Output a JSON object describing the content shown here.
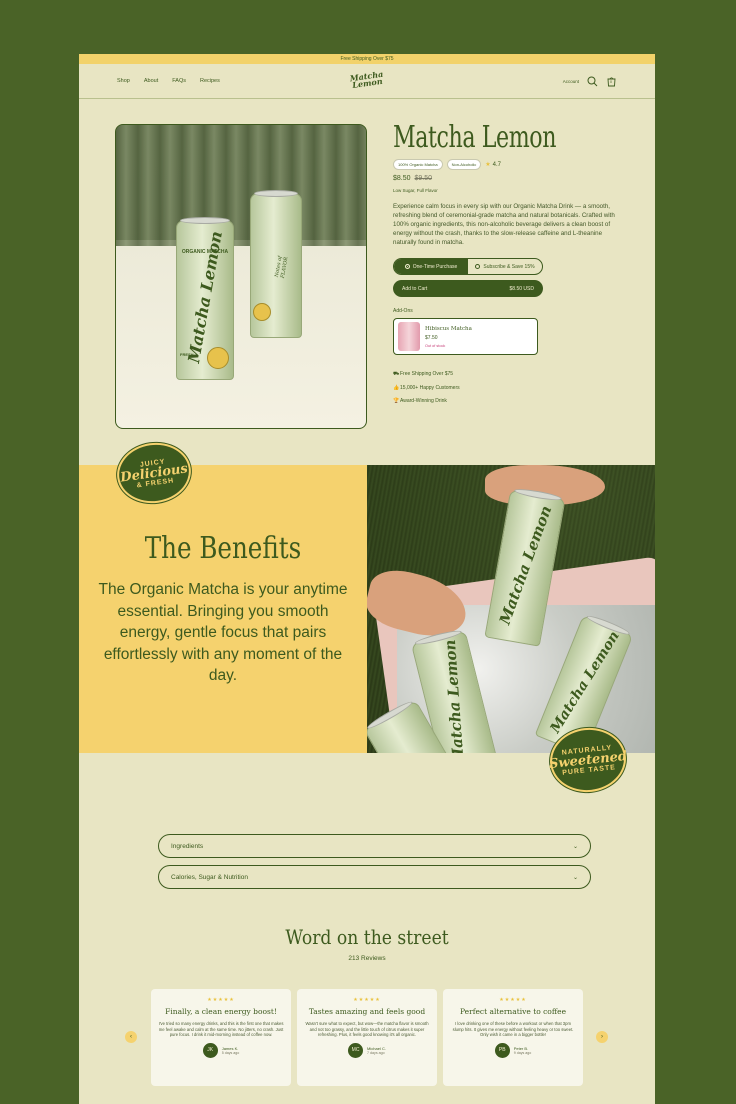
{
  "promo": "Free Shipping Over $75",
  "nav": {
    "links": [
      "Shop",
      "About",
      "FAQs",
      "Recipes"
    ],
    "logo_line1": "Matcha",
    "logo_line2": "Lemon",
    "account": "Account",
    "cart_count": "0"
  },
  "product": {
    "title": "Matcha Lemon",
    "badges": [
      "100% Organic Matcha",
      "Non-Alcoholic"
    ],
    "rating": "4.7",
    "price": "$8.50",
    "old_price": "$9.50",
    "subtitle": "Low Sugar, Full Flavor",
    "description": "Experience calm focus in every sip with our Organic Matcha Drink — a smooth, refreshing blend of ceremonial-grade matcha and natural botanicals. Crafted with 100% organic ingredients, this non-alcoholic beverage delivers a clean boost of energy without the crash, thanks to the slow-release caffeine and L-theanine naturally found in matcha.",
    "purchase_options": [
      "One-Time Purchase",
      "Subscribe & Save 15%"
    ],
    "add_to_cart": "Add to Cart",
    "cart_price": "$8.50 USD",
    "addons_label": "Add-Ons",
    "addon": {
      "name": "Hibiscus Matcha",
      "price": "$7.50",
      "stock": "Out of stock"
    },
    "perks": [
      "Free Shipping Over $75",
      "15,000+ Happy Customers",
      "Award-Winning Drink"
    ]
  },
  "can_labels": {
    "top": "ORGANIC MATCHA",
    "brand": "Matcha Lemon",
    "side": "FRESH",
    "back": "Notes of FLAVOR"
  },
  "sticker1": {
    "a": "JUICY",
    "b": "Delicious",
    "c": "& FRESH"
  },
  "sticker2": {
    "a": "NATURALLY",
    "b": "Sweetened",
    "c": "PURE TASTE"
  },
  "benefits": {
    "title": "The Benefits",
    "text": "The Organic Matcha is your anytime essential. Bringing you smooth energy, gentle focus that pairs effortlessly with any moment of the day."
  },
  "accordions": [
    "Ingredients",
    "Calories, Sugar & Nutrition"
  ],
  "reviews": {
    "title": "Word on the street",
    "count": "213 Reviews",
    "items": [
      {
        "title": "Finally, a clean energy boost!",
        "body": "I've tried so many energy drinks, and this is the first one that makes me feel awake and calm at the same time. No jitters, no crash. Just pure focus. I drink it mid-morning instead of coffee now.",
        "initials": "JK",
        "name": "James K.",
        "date": "5 days ago"
      },
      {
        "title": "Tastes amazing and feels good",
        "body": "Wasn't sure what to expect, but wow—the matcha flavor is smooth and not too grassy, and the little touch of citrus makes it super refreshing. Plus, it feels good knowing it's all organic.",
        "initials": "MC",
        "name": "Michael C.",
        "date": "7 days ago"
      },
      {
        "title": "Perfect alternative to coffee",
        "body": "I love drinking one of these before a workout or when that 3pm slump hits. It gives me energy without feeling heavy or too sweet. Only wish it came in a bigger bottle!",
        "initials": "PB",
        "name": "Peter B.",
        "date": "9 days ago"
      }
    ]
  },
  "colors": {
    "background": "#4a6327",
    "page": "#e8e5c3",
    "primary": "#3d5a1e",
    "accent": "#f5d26e"
  }
}
